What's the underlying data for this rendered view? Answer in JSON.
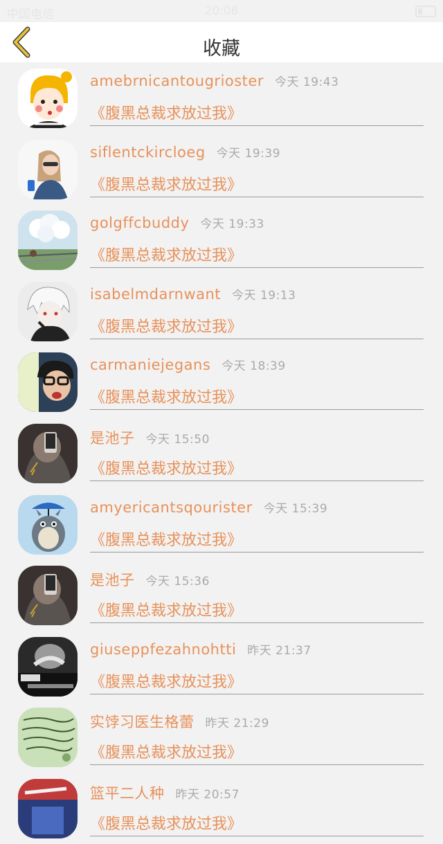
{
  "status_bar": {
    "carrier": "中国电信",
    "time": "20:08"
  },
  "header": {
    "title": "收藏",
    "back_icon": "chevron-left-icon"
  },
  "colors": {
    "accent": "#e8915a",
    "back": "#e8c23a",
    "separator": "#9a9a9a"
  },
  "items": [
    {
      "name": "amebrnicantougrioster",
      "time": "今天 19:43",
      "book": "《腹黑总裁求放过我》",
      "avatar": "cartoon-girl"
    },
    {
      "name": "siflentckircloeg",
      "time": "今天 19:39",
      "book": "《腹黑总裁求放过我》",
      "avatar": "girl-photo"
    },
    {
      "name": "golgffcbuddy",
      "time": "今天 19:33",
      "book": "《腹黑总裁求放过我》",
      "avatar": "balloons"
    },
    {
      "name": "isabelmdarnwant",
      "time": "今天 19:13",
      "book": "《腹黑总裁求放过我》",
      "avatar": "anime-boy"
    },
    {
      "name": "carmaniejegans",
      "time": "今天 18:39",
      "book": "《腹黑总裁求放过我》",
      "avatar": "glasses-boy"
    },
    {
      "name": "是池子",
      "time": "今天 15:50",
      "book": "《腹黑总裁求放过我》",
      "avatar": "phone-selfie"
    },
    {
      "name": "amyericantsqourister",
      "time": "今天 15:39",
      "book": "《腹黑总裁求放过我》",
      "avatar": "totoro"
    },
    {
      "name": "是池子",
      "time": "今天 15:36",
      "book": "《腹黑总裁求放过我》",
      "avatar": "phone-selfie"
    },
    {
      "name": "giuseppfezahnohtti",
      "time": "昨天 21:37",
      "book": "《腹黑总裁求放过我》",
      "avatar": "dark-text"
    },
    {
      "name": "实饽习医生格蕾",
      "time": "昨天 21:29",
      "book": "《腹黑总裁求放过我》",
      "avatar": "handwriting"
    },
    {
      "name": "篮平二人种",
      "time": "昨天 20:57",
      "book": "《腹黑总裁求放过我》",
      "avatar": "blue-photo"
    }
  ]
}
